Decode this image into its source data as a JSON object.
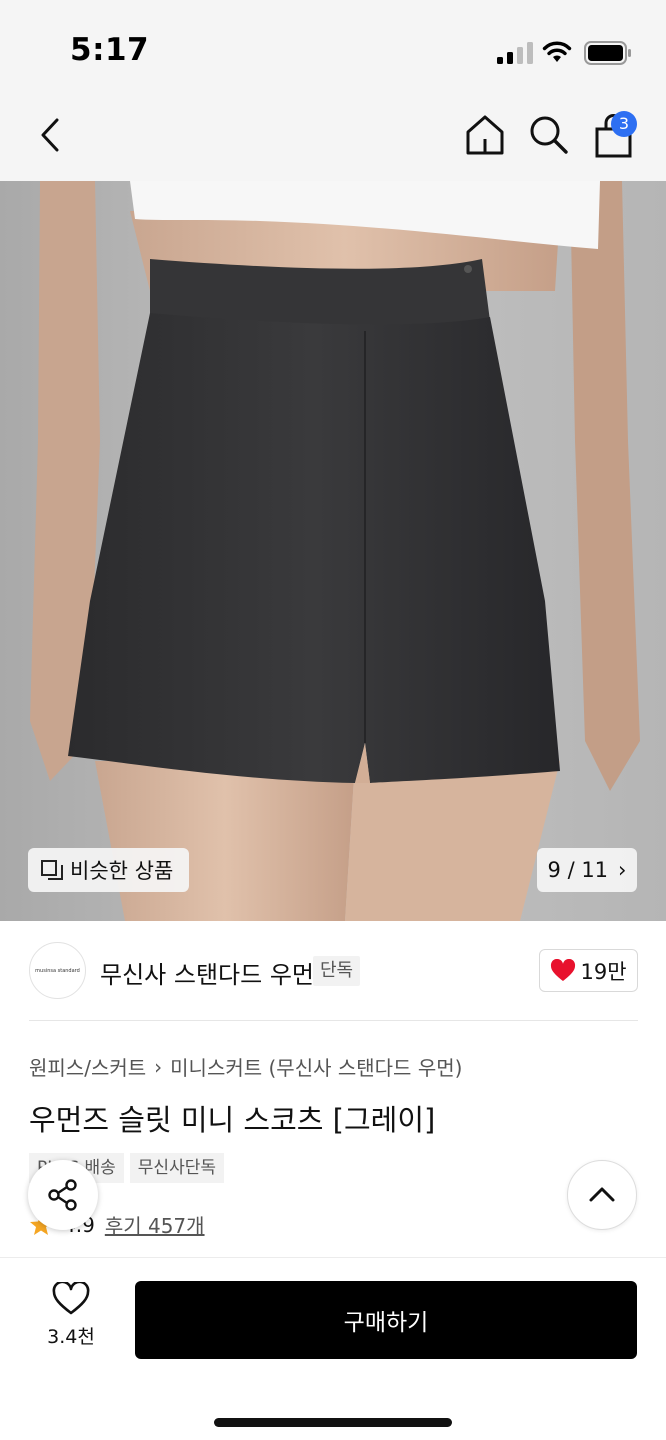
{
  "status_bar": {
    "time": "5:17"
  },
  "nav": {
    "cart_count": "3"
  },
  "hero": {
    "similar_label": "비슷한 상품",
    "page_counter": "9 / 11",
    "counter_arrow": "›"
  },
  "brand": {
    "name": "무신사 스탠다드 우먼",
    "tag": "단독",
    "logo_text": "musinsa standard",
    "likes": "19만"
  },
  "product": {
    "breadcrumb": [
      "원피스/스커트",
      "미니스커트 (무신사 스탠다드 우먼)"
    ],
    "breadcrumb_sep": "›",
    "title": "우먼즈 슬릿 미니 스코츠 [그레이]",
    "tags": [
      "PLUS 배송",
      "무신사단독"
    ],
    "rating": "4.9",
    "reviews": "후기 457개"
  },
  "bottom": {
    "wish_count": "3.4천",
    "buy_label": "구매하기"
  },
  "colors": {
    "badge": "#2d6ff2",
    "heart": "#e8112d",
    "star": "#f5a623",
    "buy_button": "#000000"
  },
  "icons": [
    "back-icon",
    "home-icon",
    "search-icon",
    "bag-icon",
    "similar-icon",
    "heart-icon",
    "star-icon",
    "share-icon",
    "chevron-up-icon",
    "heart-outline-icon"
  ]
}
